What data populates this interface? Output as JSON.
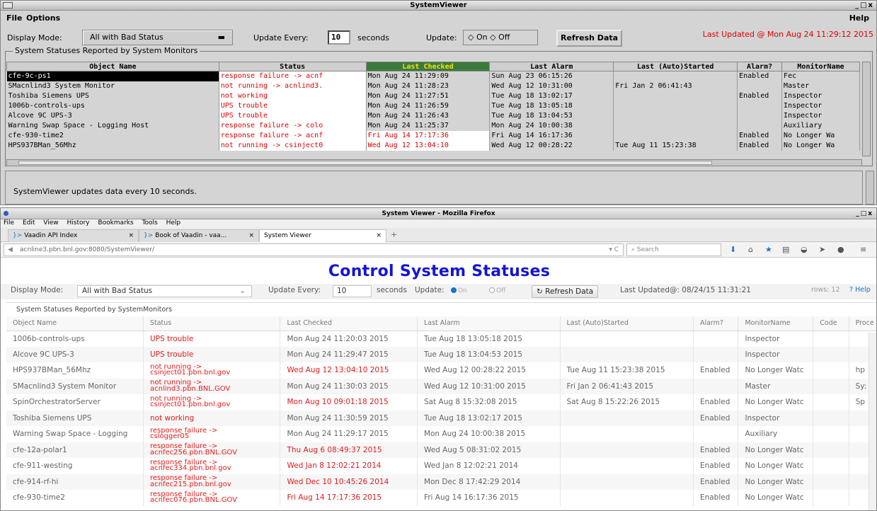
{
  "motif": {
    "title": "SystemViewer",
    "win_controls": "_□x",
    "menu": {
      "file": "File",
      "options": "Options",
      "help": "Help"
    },
    "display_mode_label": "Display Mode:",
    "display_mode_value": "All with Bad Status",
    "update_every_label": "Update Every:",
    "update_every_value": "10",
    "seconds_label": "seconds",
    "update_label": "Update:",
    "on_label": "On",
    "off_label": "Off",
    "refresh_label": "Refresh Data",
    "last_updated": "Last Updated @ Mon Aug 24 11:29:12 2015",
    "frame_label": "System Statuses Reported by System Monitors",
    "headers": [
      "Object Name",
      "Status",
      "Last Checked",
      "Last Alarm",
      "Last (Auto)Started",
      "Alarm?",
      "MonitorName"
    ],
    "rows": [
      {
        "name": "cfe-9c-ps1",
        "status": "response failure -> acnf",
        "checked": "Mon Aug 24 11:29:09",
        "alarm": "Sun Aug 23 06:15:26",
        "started": "",
        "alarm_on": "Enabled",
        "monitor": "Fec"
      },
      {
        "name": "SMacnlind3 System Monitor",
        "status": "not running -> acnlind3.",
        "checked": "Mon Aug 24 11:28:23",
        "alarm": "Wed Aug 12 10:31:00",
        "started": "Fri Jan  2 06:41:43",
        "alarm_on": "",
        "monitor": "Master"
      },
      {
        "name": "Toshiba Siemens UPS",
        "status": "not working",
        "checked": "Mon Aug 24 11:27:51",
        "alarm": "Tue Aug 18 13:02:17",
        "started": "",
        "alarm_on": "Enabled",
        "monitor": "Inspector"
      },
      {
        "name": "1006b-controls-ups",
        "status": "UPS trouble",
        "checked": "Mon Aug 24 11:26:59",
        "alarm": "Tue Aug 18 13:05:18",
        "started": "",
        "alarm_on": "",
        "monitor": "Inspector"
      },
      {
        "name": "Alcove 9C UPS-3",
        "status": "UPS trouble",
        "checked": "Mon Aug 24 11:26:43",
        "alarm": "Tue Aug 18 13:04:53",
        "started": "",
        "alarm_on": "",
        "monitor": "Inspector"
      },
      {
        "name": "Warning Swap Space - Logging Host",
        "status": "response failure -> colo",
        "checked": "Mon Aug 24 11:25:37",
        "alarm": "Mon Aug 24 10:00:38",
        "started": "",
        "alarm_on": "",
        "monitor": "Auxiliary"
      },
      {
        "name": "cfe-930-time2",
        "status": "response failure -> acnf",
        "checked": "Fri Aug 14 17:17:36",
        "alarm": "Fri Aug 14 16:17:36",
        "started": "",
        "alarm_on": "Enabled",
        "monitor": "No Longer Wa"
      },
      {
        "name": "HPS937BMan_56Mhz",
        "status": "not running -> csinject0",
        "checked": "Wed Aug 12 13:04:10",
        "alarm": "Wed Aug 12 00:28:22",
        "started": "Tue Aug 11 15:23:38",
        "alarm_on": "Enabled",
        "monitor": "No Longer Wa"
      }
    ],
    "message": "SystemViewer updates data every 10 seconds."
  },
  "firefox": {
    "title": "System Viewer - Mozilla Firefox",
    "win_controls": "_□x",
    "menu": [
      "File",
      "Edit",
      "View",
      "History",
      "Bookmarks",
      "Tools",
      "Help"
    ],
    "tabs": [
      "Vaadin API Index",
      "Book of Vaadin - vaa...",
      "System Viewer"
    ],
    "url": "acnline3.pbn.bnl.gov:8080/SystemViewer/",
    "search_placeholder": "Search"
  },
  "vaadin": {
    "title": "Control System Statuses",
    "display_mode_label": "Display Mode:",
    "display_mode_value": "All with Bad Status",
    "update_every_label": "Update Every:",
    "update_every_value": "10",
    "seconds_label": "seconds",
    "update_label": "Update:",
    "on_label": "On",
    "off_label": "Off",
    "refresh_label": "Refresh Data",
    "last_updated": "Last Updated@: 08/24/15 11:31:21",
    "rows_label": "rows: 12",
    "help_label": "Help",
    "frame_label": "System Statuses Reported by SystemMonitors",
    "headers": [
      "Object Name",
      "Status",
      "Last Checked",
      "Last Alarm",
      "Last (Auto)Started",
      "Alarm?",
      "MonitorName",
      "Code",
      "Proce"
    ],
    "rows": [
      {
        "name": "1006b-controls-ups",
        "s1": "UPS trouble",
        "s2": "",
        "checked": "Mon Aug 24 11:20:03 2015",
        "checked_red": false,
        "alarm": "Tue Aug 18 13:05:18 2015",
        "started": "",
        "alarm_on": "",
        "monitor": "Inspector",
        "code": "",
        "proc": ""
      },
      {
        "name": "Alcove 9C UPS-3",
        "s1": "UPS trouble",
        "s2": "",
        "checked": "Mon Aug 24 11:29:47 2015",
        "checked_red": false,
        "alarm": "Tue Aug 18 13:04:53 2015",
        "started": "",
        "alarm_on": "",
        "monitor": "Inspector",
        "code": "",
        "proc": ""
      },
      {
        "name": "HPS937BMan_56Mhz",
        "s1": "not running ->",
        "s2": "csinject01.pbn.bnl.gov",
        "checked": "Wed Aug 12 13:04:10 2015",
        "checked_red": true,
        "alarm": "Wed Aug 12 00:28:22 2015",
        "started": "Tue Aug 11 15:23:38 2015",
        "alarm_on": "Enabled",
        "monitor": "No Longer Watc",
        "code": "",
        "proc": "hp"
      },
      {
        "name": "SMacnlind3 System Monitor",
        "s1": "not running ->",
        "s2": "acnlind3.pbn.BNL.GOV",
        "checked": "Mon Aug 24 11:30:03 2015",
        "checked_red": false,
        "alarm": "Wed Aug 12 10:31:00 2015",
        "started": "Fri Jan 2 06:41:43 2015",
        "alarm_on": "",
        "monitor": "Master",
        "code": "",
        "proc": "Sy:"
      },
      {
        "name": "SpinOrchestratorServer",
        "s1": "not running ->",
        "s2": "csinject01.pbn.bnl.gov",
        "checked": "Mon Aug 10 09:01:18 2015",
        "checked_red": true,
        "alarm": "Sat Aug 8 15:32:08 2015",
        "started": "Sat Aug 8 15:22:26 2015",
        "alarm_on": "Enabled",
        "monitor": "No Longer Watc",
        "code": "",
        "proc": "Sp"
      },
      {
        "name": "Toshiba Siemens UPS",
        "s1": "not working",
        "s2": "",
        "checked": "Mon Aug 24 11:30:59 2015",
        "checked_red": false,
        "alarm": "Tue Aug 18 13:02:17 2015",
        "started": "",
        "alarm_on": "Enabled",
        "monitor": "Inspector",
        "code": "",
        "proc": ""
      },
      {
        "name": "Warning Swap Space - Logging",
        "s1": "response failure ->",
        "s2": "cslogger05",
        "checked": "Mon Aug 24 11:29:17 2015",
        "checked_red": false,
        "alarm": "Mon Aug 24 10:00:38 2015",
        "started": "",
        "alarm_on": "",
        "monitor": "Auxiliary",
        "code": "",
        "proc": ""
      },
      {
        "name": "cfe-12a-polar1",
        "s1": "response failure ->",
        "s2": "acnfec256.pbn.BNL.GOV",
        "checked": "Thu Aug 6 08:49:37 2015",
        "checked_red": true,
        "alarm": "Wed Aug 5 08:31:02 2015",
        "started": "",
        "alarm_on": "Enabled",
        "monitor": "No Longer Watc",
        "code": "",
        "proc": ""
      },
      {
        "name": "cfe-911-westing",
        "s1": "response failure ->",
        "s2": "acnfec334.pbn.bnl.gov",
        "checked": "Wed Jan 8 12:02:21 2014",
        "checked_red": true,
        "alarm": "Wed Jan 8 12:02:21 2014",
        "started": "",
        "alarm_on": "Enabled",
        "monitor": "No Longer Watc",
        "code": "",
        "proc": ""
      },
      {
        "name": "cfe-914-rf-hi",
        "s1": "response failure ->",
        "s2": "acnfec215.pbn.bnl.gov",
        "checked": "Wed Dec 10 10:45:26 2014",
        "checked_red": true,
        "alarm": "Mon Dec 8 17:42:29 2014",
        "started": "",
        "alarm_on": "Enabled",
        "monitor": "No Longer Watc",
        "code": "",
        "proc": ""
      },
      {
        "name": "cfe-930-time2",
        "s1": "response failure ->",
        "s2": "acnfec076.pbn.BNL.GOV",
        "checked": "Fri Aug 14 17:17:36 2015",
        "checked_red": true,
        "alarm": "Fri Aug 14 16:17:36 2015",
        "started": "",
        "alarm_on": "Enabled",
        "monitor": "No Longer Watc",
        "code": "",
        "proc": ""
      }
    ]
  }
}
